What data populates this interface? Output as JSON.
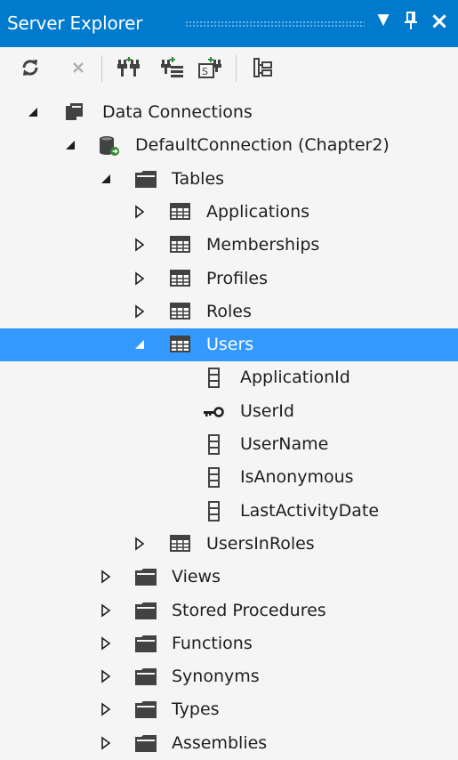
{
  "panel": {
    "title": "Server Explorer",
    "dropdown_glyph": "▼",
    "pin_glyph": "⊥",
    "close_glyph": "×"
  },
  "toolbar": {
    "buttons": [
      {
        "icon": "refresh-icon"
      },
      {
        "icon": "stop-icon"
      },
      {
        "icon": "connect-to-database-icon"
      },
      {
        "icon": "connect-to-server-icon"
      },
      {
        "icon": "connect-to-sharepoint-icon"
      },
      {
        "icon": "show-table-data-icon"
      }
    ]
  },
  "tree": {
    "data_connections": "Data Connections",
    "connection": "DefaultConnection (Chapter2)",
    "tables": "Tables",
    "table_items": [
      "Applications",
      "Memberships",
      "Profiles",
      "Roles"
    ],
    "users": "Users",
    "columns": [
      {
        "name": "ApplicationId",
        "icon": "column-icon"
      },
      {
        "name": "UserId",
        "icon": "primary-key-icon"
      },
      {
        "name": "UserName",
        "icon": "column-icon"
      },
      {
        "name": "IsAnonymous",
        "icon": "column-icon"
      },
      {
        "name": "LastActivityDate",
        "icon": "column-icon"
      }
    ],
    "users_in_roles": "UsersInRoles",
    "folders": [
      "Views",
      "Stored Procedures",
      "Functions",
      "Synonyms",
      "Types",
      "Assemblies"
    ]
  },
  "colors": {
    "title_bar": "#007acc",
    "selection": "#3399ff",
    "background": "#f5f5f5"
  }
}
